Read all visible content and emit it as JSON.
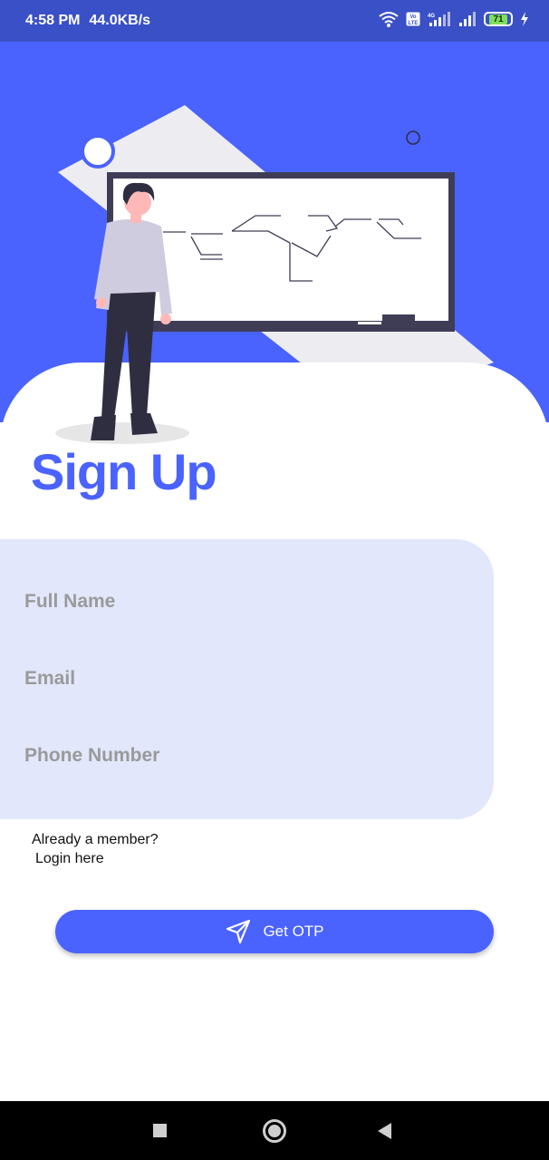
{
  "status_bar": {
    "time": "4:58 PM",
    "speed": "44.0KB/s",
    "battery": "71",
    "icons": [
      "wifi-icon",
      "volte-icon",
      "signal-icon",
      "battery-icon",
      "charging-icon"
    ]
  },
  "page": {
    "title": "Sign Up"
  },
  "form": {
    "full_name_placeholder": "Full Name",
    "email_placeholder": "Email",
    "phone_placeholder": "Phone Number"
  },
  "login": {
    "prompt": "Already a member?",
    "link": "Login here"
  },
  "otp_button": {
    "label": "Get OTP",
    "icon": "send-icon"
  },
  "nav": {
    "icons": [
      "recent-apps-icon",
      "home-icon",
      "back-icon"
    ]
  },
  "colors": {
    "accent": "#4a63ff",
    "status_bar": "#3a50c6",
    "form_bg": "#e2e7fb"
  }
}
